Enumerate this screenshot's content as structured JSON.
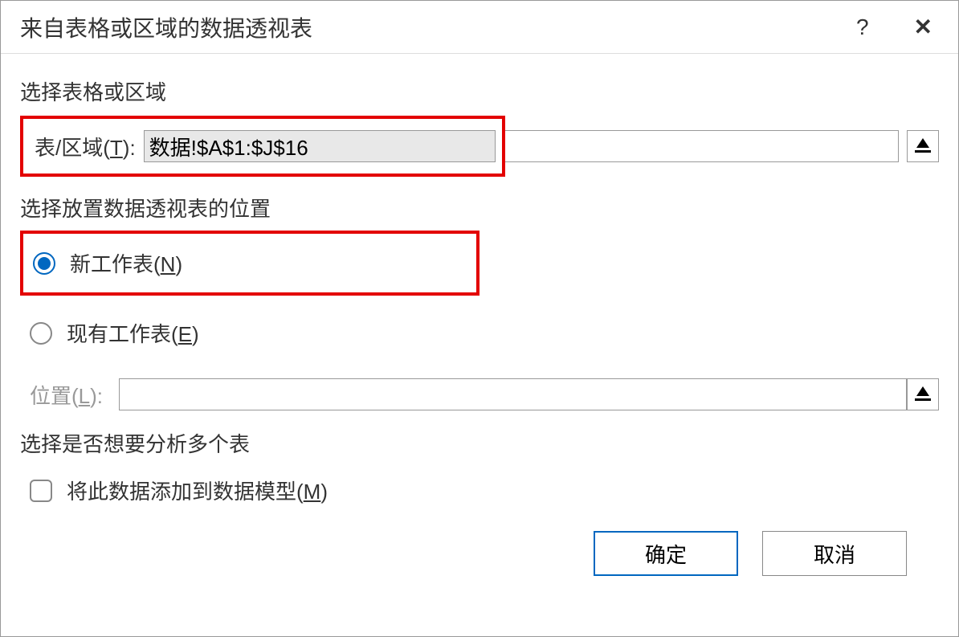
{
  "dialog": {
    "title": "来自表格或区域的数据透视表",
    "help_symbol": "?",
    "close_symbol": "✕"
  },
  "section_select_range": {
    "label": "选择表格或区域",
    "row_label_prefix": "表/区域(",
    "row_label_hotkey": "T",
    "row_label_suffix": "): ",
    "input_value": "数据!$A$1:$J$16"
  },
  "section_placement": {
    "label": "选择放置数据透视表的位置",
    "radio_new": {
      "label_prefix": "新工作表(",
      "hotkey": "N",
      "label_suffix": ")",
      "selected": true
    },
    "radio_existing": {
      "label_prefix": "现有工作表(",
      "hotkey": "E",
      "label_suffix": ")",
      "selected": false
    },
    "location": {
      "label_prefix": "位置(",
      "hotkey": "L",
      "label_suffix": "):",
      "input_value": ""
    }
  },
  "section_multiple": {
    "label": "选择是否想要分析多个表",
    "checkbox": {
      "label_prefix": "将此数据添加到数据模型(",
      "hotkey": "M",
      "label_suffix": ")",
      "checked": false
    }
  },
  "buttons": {
    "ok": "确定",
    "cancel": "取消"
  }
}
